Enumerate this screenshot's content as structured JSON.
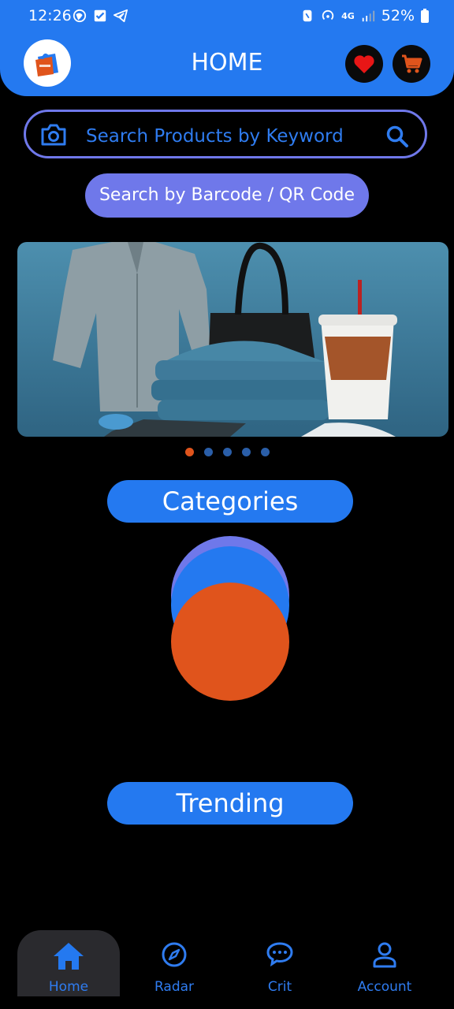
{
  "status_bar": {
    "time": "12:26",
    "battery": "52%",
    "network": "4G"
  },
  "header": {
    "title": "HOME"
  },
  "search": {
    "placeholder": "Search Products by Keyword"
  },
  "barcode_button": {
    "label": "Search by Barcode / QR Code"
  },
  "carousel": {
    "slides": 5,
    "active_index": 0
  },
  "sections": {
    "categories": "Categories",
    "trending": "Trending"
  },
  "bottom_nav": {
    "items": [
      {
        "label": "Home",
        "icon": "home-icon",
        "active": true
      },
      {
        "label": "Radar",
        "icon": "compass-icon",
        "active": false
      },
      {
        "label": "Crit",
        "icon": "chat-icon",
        "active": false
      },
      {
        "label": "Account",
        "icon": "person-icon",
        "active": false
      }
    ]
  },
  "colors": {
    "primary": "#2479f0",
    "accent": "#e0541c",
    "secondary": "#6f78ea",
    "background": "#000000"
  }
}
